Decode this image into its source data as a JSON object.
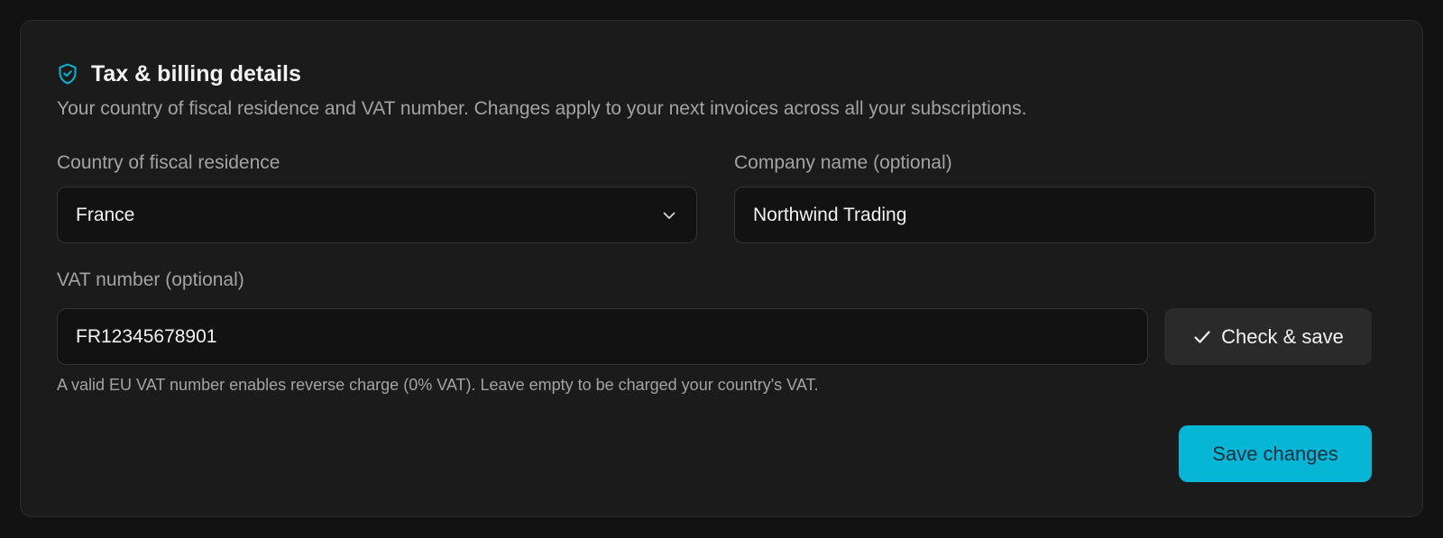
{
  "header": {
    "title": "Tax & billing details",
    "subtitle": "Your country of fiscal residence and VAT number. Changes apply to your next invoices across all your subscriptions.",
    "icon": "shield-check-icon"
  },
  "country": {
    "label": "Country of fiscal residence",
    "value": "France",
    "icon": "chevron-down-icon"
  },
  "company": {
    "label": "Company name (optional)",
    "value": "Northwind Trading"
  },
  "vat": {
    "label": "VAT number (optional)",
    "value": "FR12345678901",
    "helper": "A valid EU VAT number enables reverse charge (0% VAT). Leave empty to be charged your country's VAT."
  },
  "buttons": {
    "check_save": "Check & save",
    "check_icon": "check-icon",
    "save_changes": "Save changes"
  },
  "colors": {
    "accent": "#06b6d4",
    "background": "#121212",
    "card": "#1b1b1b"
  }
}
